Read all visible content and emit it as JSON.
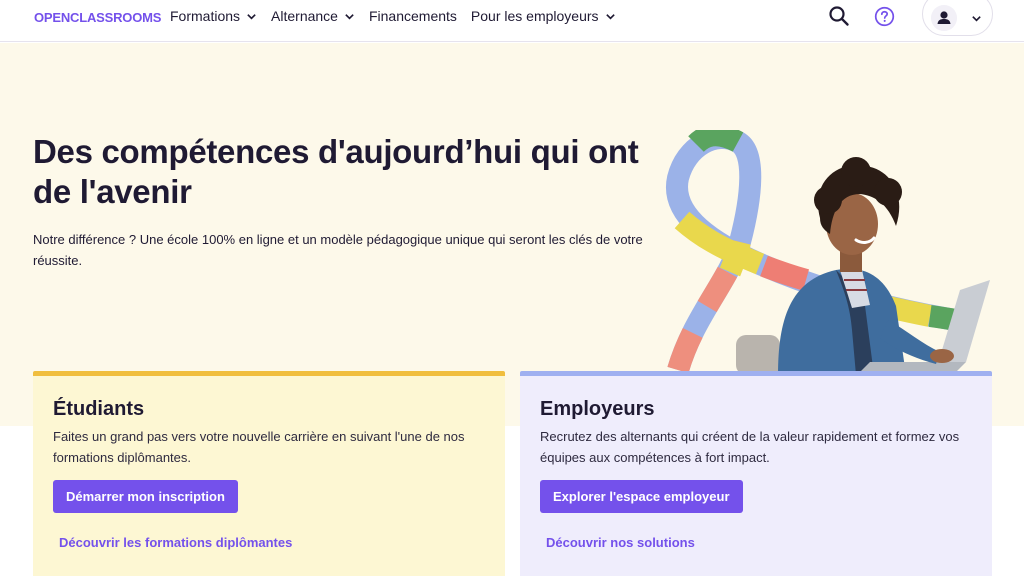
{
  "header": {
    "logo": "OPENCLASSROOMS",
    "nav": [
      {
        "label": "Formations",
        "has_dropdown": true
      },
      {
        "label": "Alternance",
        "has_dropdown": true
      },
      {
        "label": "Financements",
        "has_dropdown": false
      },
      {
        "label": "Pour les employeurs",
        "has_dropdown": true
      }
    ],
    "icons": {
      "search": "search-icon",
      "help": "help-circle-icon",
      "user": "user-icon",
      "user_menu": "chevron-down-icon"
    }
  },
  "hero": {
    "title": "Des compétences d'aujourd’hui qui ont de l'avenir",
    "subtitle": "Notre différence ? Une école 100% en ligne et un modèle pédagogique unique qui seront les clés de votre réussite."
  },
  "cards": {
    "students": {
      "title": "Étudiants",
      "text": "Faites un grand pas vers votre nouvelle carrière en suivant l'une de nos formations diplômantes.",
      "button": "Démarrer mon inscription",
      "link": "Découvrir les formations diplômantes"
    },
    "employers": {
      "title": "Employeurs",
      "text": "Recrutez des alternants qui créent de la valeur rapidement et formez vos équipes aux compétences à fort impact.",
      "button": "Explorer l'espace employeur",
      "link": "Découvrir nos solutions"
    }
  },
  "colors": {
    "brand": "#7451eb",
    "hero_background": "#fdf9ea",
    "students_card": "#fdf7d3",
    "students_accent": "#f0be3e",
    "employers_card": "#efedfc",
    "employers_accent": "#9fb0f0",
    "text": "#1f1a33"
  }
}
